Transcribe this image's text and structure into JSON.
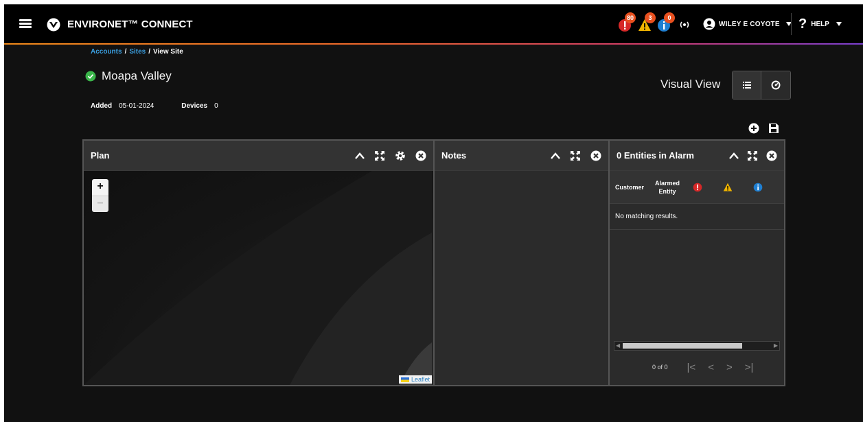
{
  "app": {
    "title": "ENVIRONET™ CONNECT",
    "notifications": [
      {
        "type": "critical",
        "count": "80",
        "color": "#d62828",
        "icon": "alarm-critical-icon"
      },
      {
        "type": "warning",
        "count": "3",
        "color": "#f0b400",
        "icon": "warning-icon"
      },
      {
        "type": "info",
        "count": "0",
        "color": "#1f7fd1",
        "icon": "info-icon"
      }
    ],
    "signal_icon": "(ꟷ)",
    "user_name": "WILEY E COYOTE",
    "help_label": "HELP"
  },
  "breadcrumb": {
    "accounts": "Accounts",
    "sites": "Sites",
    "current": "View Site",
    "separator": "/"
  },
  "site": {
    "name": "Moapa Valley",
    "status_color": "#3ab54a",
    "added_label": "Added",
    "added_value": "05-01-2024",
    "devices_label": "Devices",
    "devices_value": "0"
  },
  "view": {
    "label": "Visual View",
    "buttons": [
      "list-view",
      "dashboard-view"
    ]
  },
  "panels": {
    "plan": {
      "title": "Plan",
      "zoom_in": "+",
      "zoom_out": "−",
      "attribution": "Leaflet"
    },
    "notes": {
      "title": "Notes"
    },
    "alarms": {
      "title": "0 Entities in Alarm",
      "columns": {
        "customer": "Customer",
        "alarmed_entity_line1": "Alarmed",
        "alarmed_entity_line2": "Entity"
      },
      "empty_text": "No matching results.",
      "pager_count": "0 of 0",
      "pager_first": "|<",
      "pager_prev": "<",
      "pager_next": ">",
      "pager_last": ">|"
    }
  }
}
